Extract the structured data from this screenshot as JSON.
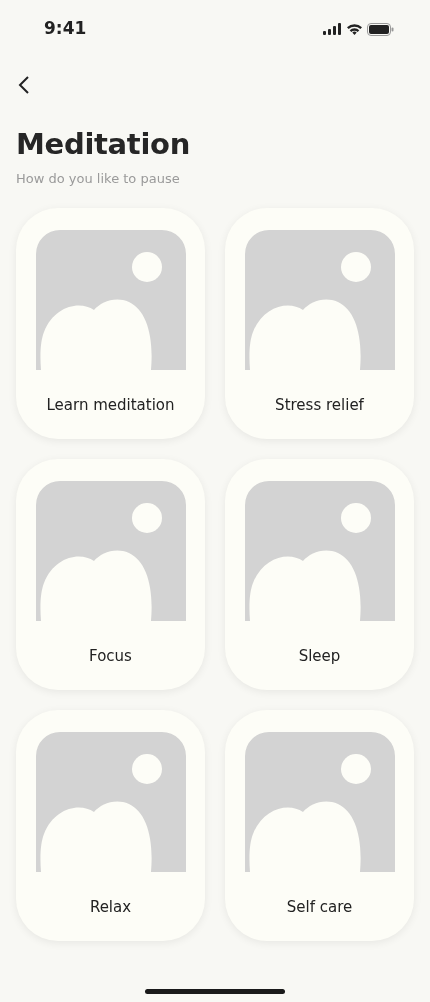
{
  "status_bar": {
    "time": "9:41"
  },
  "header": {
    "title": "Meditation",
    "subtitle": "How do you like to pause"
  },
  "categories": [
    {
      "label": "Learn meditation"
    },
    {
      "label": "Stress relief"
    },
    {
      "label": "Focus"
    },
    {
      "label": "Sleep"
    },
    {
      "label": "Relax"
    },
    {
      "label": "Self care"
    }
  ]
}
